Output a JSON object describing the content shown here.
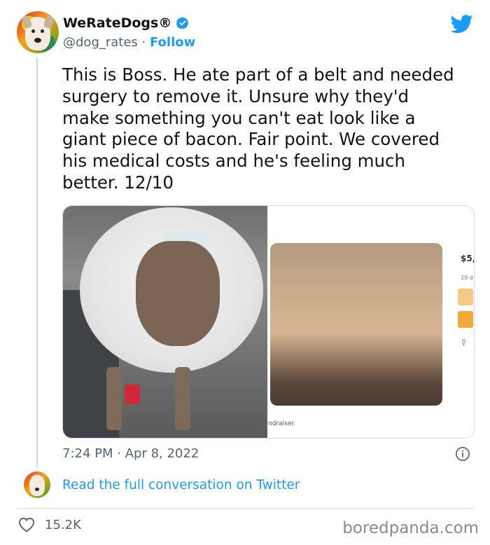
{
  "account": {
    "display_name": "WeRateDogs",
    "registered_mark": "®",
    "handle": "@dog_rates",
    "separator": " · ",
    "follow_label": "Follow"
  },
  "tweet": {
    "text": "This is Boss. He ate part of a belt and needed\nsurgery to remove it. Unsure why they'd\nmake something you can't eat look like a\ngiant piece of bacon. Fair point. We covered\nhis medical costs and he's feeling much\nbetter. 12/10",
    "time": "7:24 PM",
    "dot": " · ",
    "date": "Apr 8, 2022"
  },
  "media": {
    "fundraiser_amount": "$5,",
    "fundraiser_days": "29 d",
    "fundraiser_caption": "ndraiser."
  },
  "conversation": {
    "link_text": "Read the full conversation on Twitter"
  },
  "engagement": {
    "likes": "15.2K"
  },
  "watermark": "boredpanda.com",
  "colors": {
    "accent": "#1d9bf0",
    "text": "#0f1419",
    "muted": "#536471",
    "border": "#cfd9de"
  },
  "icons": [
    "verified-badge-icon",
    "twitter-bird-icon",
    "info-icon",
    "heart-icon"
  ]
}
